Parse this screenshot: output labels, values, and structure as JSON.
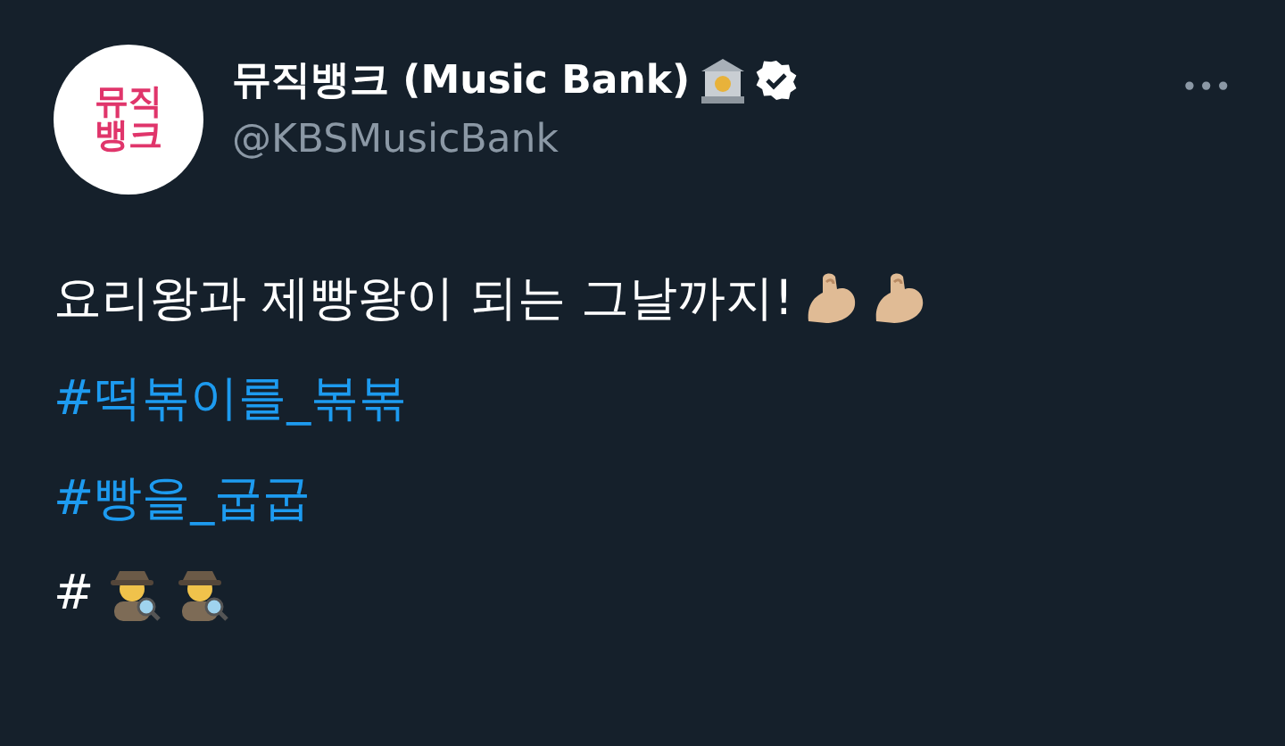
{
  "author": {
    "avatar_text": "뮤직뱅크",
    "name": "뮤직뱅크 (Music Bank)",
    "verified": true,
    "handle": "@KBSMusicBank"
  },
  "more": "•••",
  "tweet": {
    "text": "요리왕과 제빵왕이 되는 그날까지!",
    "hashtags": [
      "#떡볶이를_볶볶",
      "#빵을_굽굽"
    ],
    "last_line": "#"
  }
}
